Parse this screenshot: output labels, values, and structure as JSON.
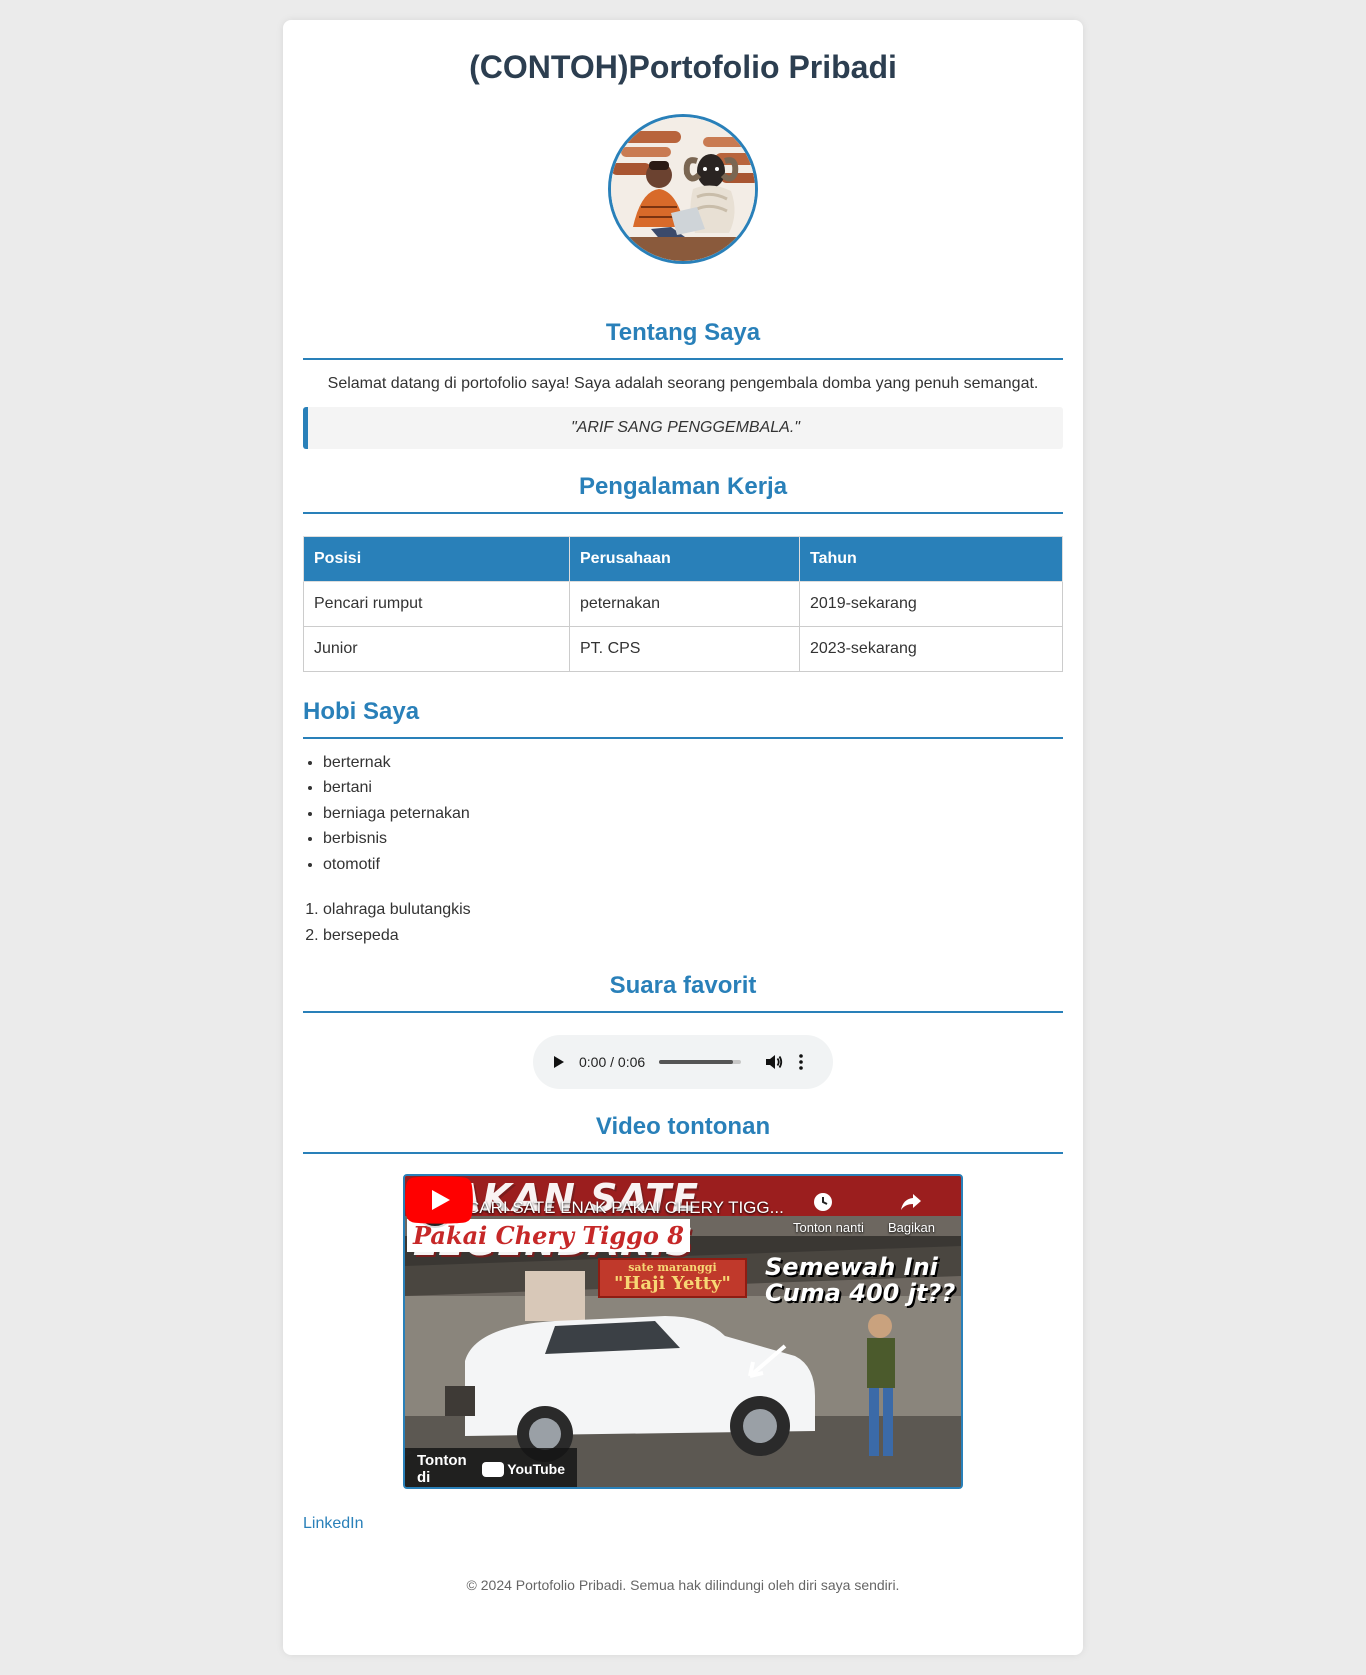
{
  "header": {
    "title": "(CONTOH)Portofolio Pribadi"
  },
  "about": {
    "heading": "Tentang Saya",
    "text": "Selamat datang di portofolio saya! Saya adalah seorang pengembala domba yang penuh semangat.",
    "quote": "\"ARIF SANG PENGGEMBALA.\""
  },
  "experience": {
    "heading": "Pengalaman Kerja",
    "columns": [
      "Posisi",
      "Perusahaan",
      "Tahun"
    ],
    "rows": [
      [
        "Pencari rumput",
        "peternakan",
        "2019-sekarang"
      ],
      [
        "Junior",
        "PT. CPS",
        "2023-sekarang"
      ]
    ]
  },
  "hobbies": {
    "heading": "Hobi Saya",
    "unordered": [
      "berternak",
      "bertani",
      "berniaga peternakan",
      "berbisnis",
      "otomotif"
    ],
    "ordered": [
      "olahraga bulutangkis",
      "bersepeda"
    ]
  },
  "audio": {
    "heading": "Suara favorit",
    "time": "0:00 / 0:06",
    "progress": 0.9
  },
  "video": {
    "heading": "Video tontonan",
    "title": "CARI SATE ENAK PAKAI CHERY TIGG...",
    "watch_later": "Tonton nanti",
    "share": "Bagikan",
    "banner_main": "MAKAN SATE LEGENDARIS",
    "banner_sub": "Pakai Chery Tiggo 8",
    "sign_top": "sate maranggi",
    "sign_main": "\"Haji Yetty\"",
    "promo_line1": "Semewah Ini",
    "promo_line2": "Cuma 400 jt??",
    "watch_on": "Tonton di",
    "platform": "YouTube"
  },
  "links": {
    "linkedin": "LinkedIn"
  },
  "footer": {
    "text": "© 2024 Portofolio Pribadi. Semua hak dilindungi oleh diri saya sendiri."
  },
  "colors": {
    "accent": "#2980b9",
    "title": "#2c3e50",
    "background": "#ebebeb"
  }
}
